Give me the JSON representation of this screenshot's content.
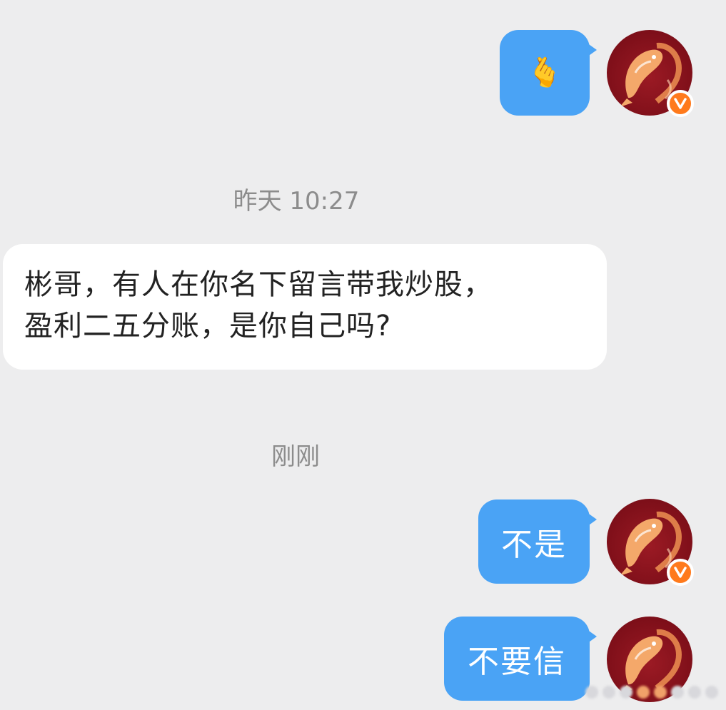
{
  "conversation": {
    "messages": [
      {
        "direction": "outgoing",
        "type": "emoji",
        "content": "🫰",
        "emoji_name": "finger-heart-emoji"
      },
      {
        "type": "timestamp",
        "text": "昨天 10:27"
      },
      {
        "direction": "incoming",
        "type": "text",
        "text": "彬哥，有人在你名下留言带我炒股，\n盈利二五分账，是你自己吗?"
      },
      {
        "type": "timestamp",
        "text": "刚刚"
      },
      {
        "direction": "outgoing",
        "type": "text",
        "text": "不是"
      },
      {
        "direction": "outgoing",
        "type": "text",
        "text": "不要信"
      }
    ]
  },
  "avatar": {
    "icon": "koi-fish-icon",
    "verified_badge_icon": "verified-v-icon",
    "background_color": "#8a1420",
    "badge_color": "#ff7a1c"
  },
  "colors": {
    "background": "#ededee",
    "outgoing_bubble": "#4aa3f5",
    "incoming_bubble": "#ffffff",
    "timestamp_text": "#8c8c8c"
  }
}
